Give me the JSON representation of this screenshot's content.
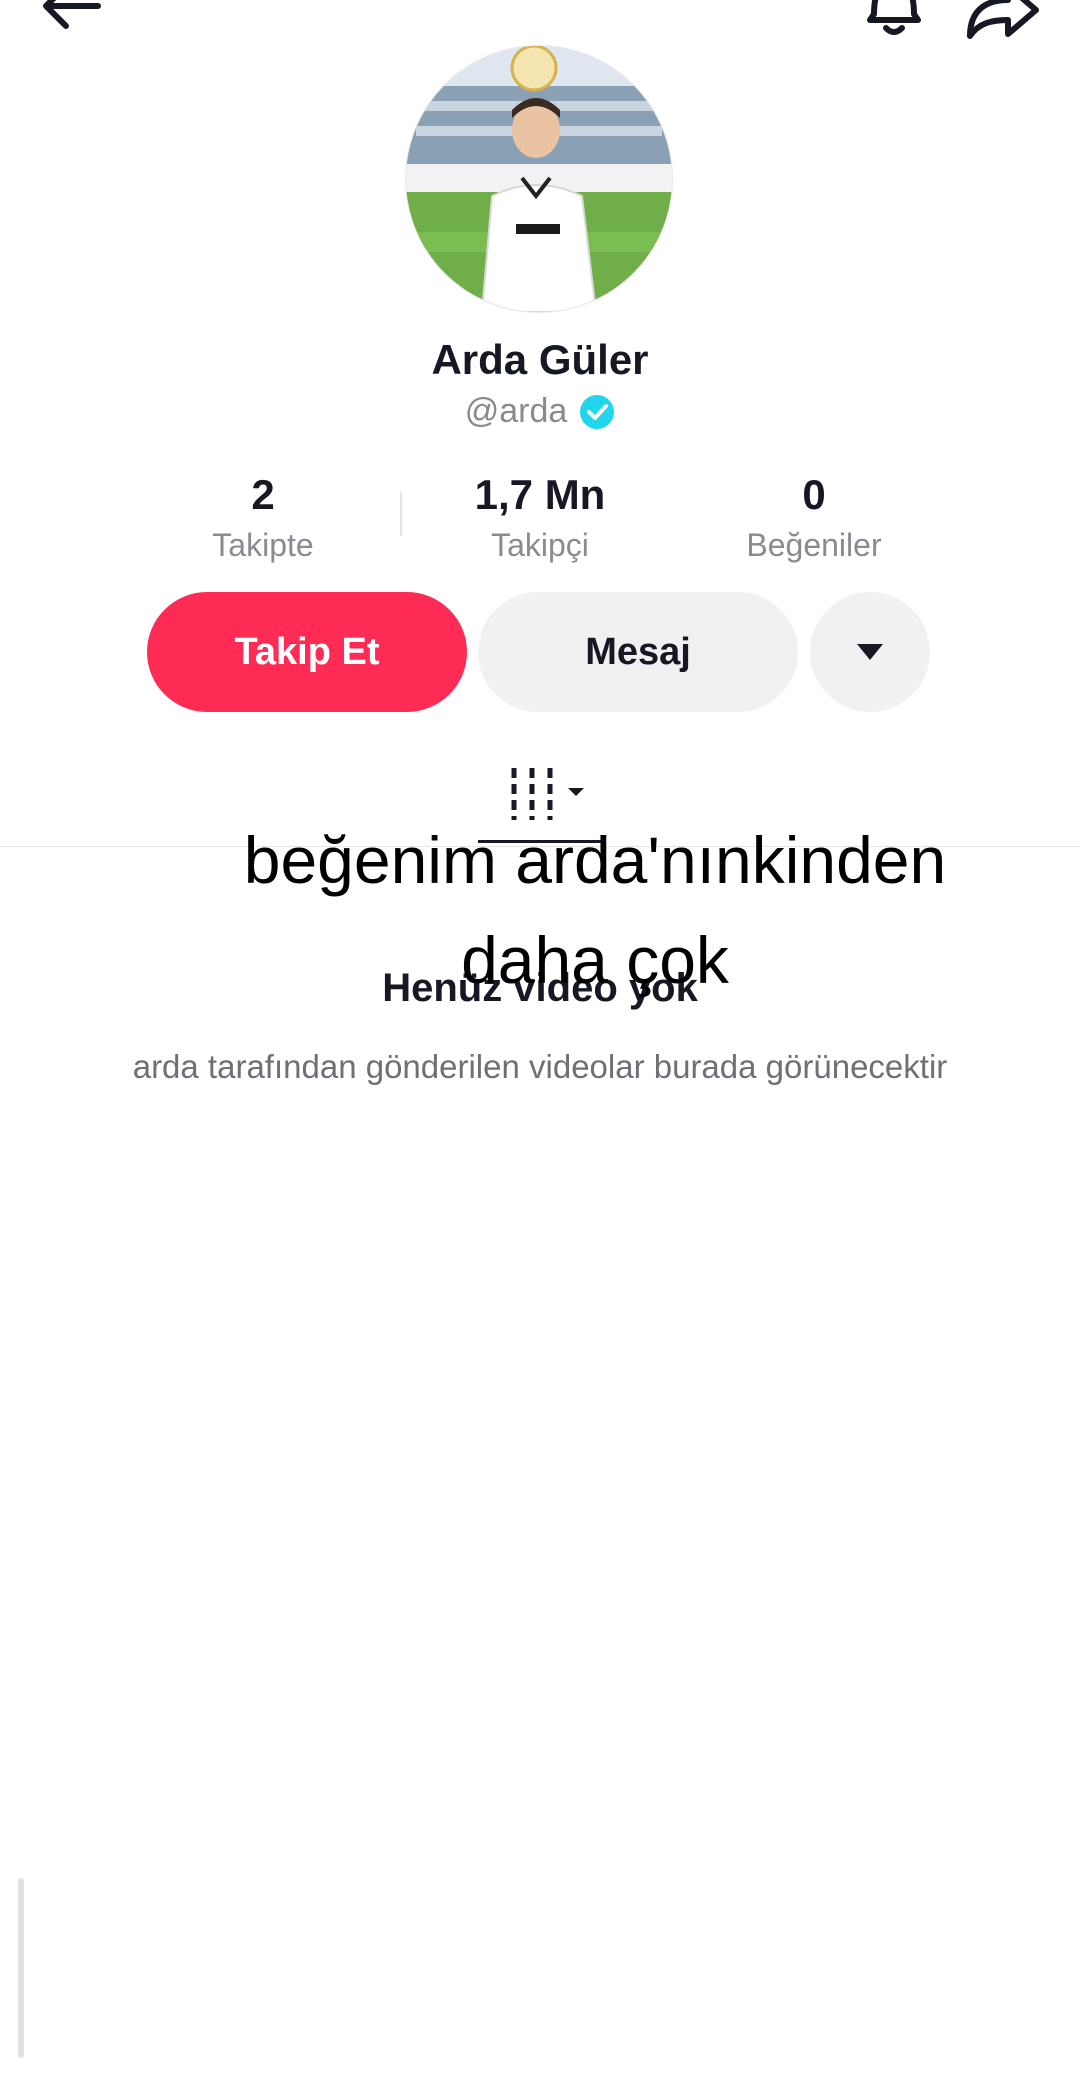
{
  "header": {
    "back_icon": "arrow-left-icon",
    "bell_icon": "bell-icon",
    "share_icon": "share-icon"
  },
  "profile": {
    "name": "Arda Güler",
    "handle": "@arda",
    "verified": true
  },
  "stats": [
    {
      "value": "2",
      "label": "Takipte"
    },
    {
      "value": "1,7 Mn",
      "label": "Takipçi"
    },
    {
      "value": "0",
      "label": "Beğeniler"
    }
  ],
  "actions": {
    "follow_label": "Takip Et",
    "message_label": "Mesaj",
    "more_icon": "caret-down-icon"
  },
  "overlay_text": {
    "line1": "beğenim arda'nınkinden",
    "line2": "daha çok"
  },
  "empty_state": {
    "title": "Henüz video yok",
    "description": "arda tarafından gönderilen videolar burada görünecektir"
  },
  "colors": {
    "accent": "#fe2c55",
    "verified": "#20d5ec",
    "secondary_text": "#8a8b91"
  }
}
